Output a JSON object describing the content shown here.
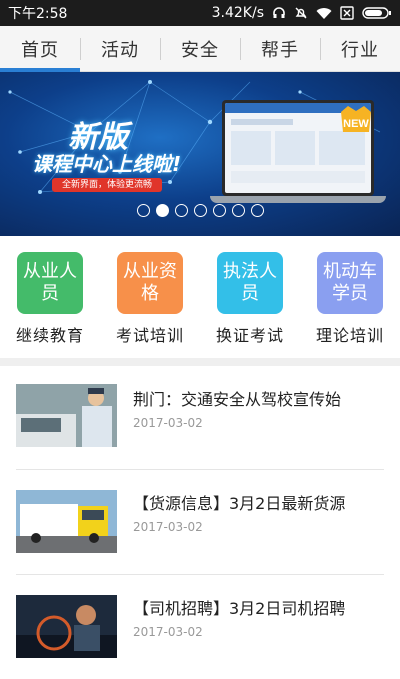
{
  "status_bar": {
    "time": "下午2:58",
    "speed": "3.42K/s"
  },
  "tabs": [
    {
      "label": "首页",
      "active": true
    },
    {
      "label": "活动",
      "active": false
    },
    {
      "label": "安全",
      "active": false
    },
    {
      "label": "帮手",
      "active": false
    },
    {
      "label": "行业",
      "active": false
    }
  ],
  "banner": {
    "title": "新版",
    "subtitle": "课程中心上线啦!",
    "tagline": "全新界面，体验更流畅",
    "badge": "NEW",
    "dots": 7,
    "active_dot": 2
  },
  "quick_links": [
    {
      "icon_text": "从业人员",
      "label": "继续教育",
      "color": "#44bb6a"
    },
    {
      "icon_text": "从业资格",
      "label": "考试培训",
      "color": "#f7904a"
    },
    {
      "icon_text": "执法人员",
      "label": "换证考试",
      "color": "#33bfe8"
    },
    {
      "icon_text": "机动车学员",
      "label": "理论培训",
      "color": "#8a9ff0"
    }
  ],
  "news": [
    {
      "title": "荆门：交通安全从驾校宣传始",
      "date": "2017-03-02"
    },
    {
      "title": "【货源信息】3月2日最新货源",
      "date": "2017-03-02"
    },
    {
      "title": "【司机招聘】3月2日司机招聘",
      "date": "2017-03-02"
    }
  ],
  "colors": {
    "accent": "#2a7fd4",
    "status_bar": "#1c1c1c"
  }
}
